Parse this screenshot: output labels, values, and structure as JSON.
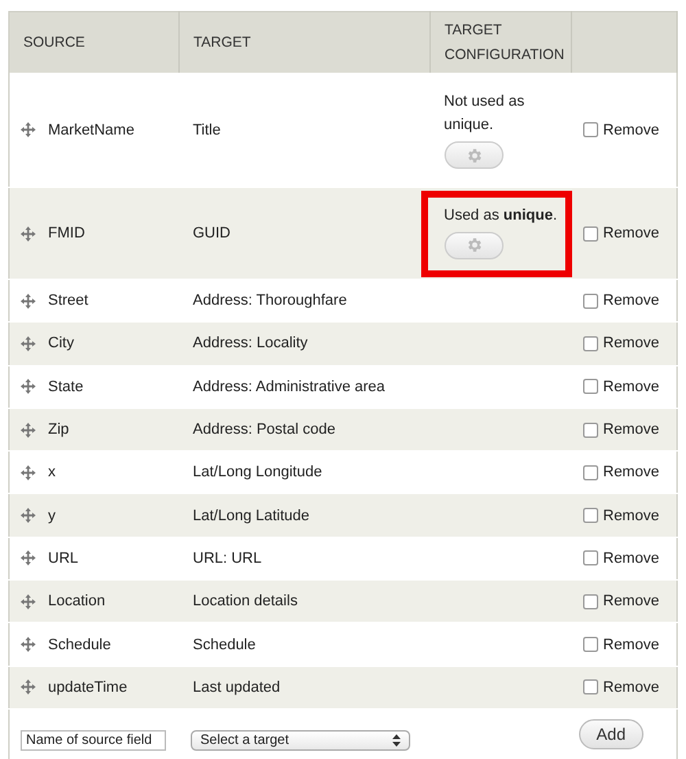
{
  "table": {
    "columns": [
      "SOURCE",
      "TARGET",
      "TARGET CONFIGURATION"
    ],
    "rows": [
      {
        "source": "MarketName",
        "target": "Title",
        "config": {
          "text": "Not used as unique.",
          "highlighted": false
        },
        "remove_label": "Remove",
        "remove_checked": false
      },
      {
        "source": "FMID",
        "target": "GUID",
        "config": {
          "text": "Used as **unique**.",
          "highlighted": true
        },
        "remove_label": "Remove",
        "remove_checked": false
      },
      {
        "source": "Street",
        "target": "Address: Thoroughfare",
        "remove_label": "Remove",
        "remove_checked": false
      },
      {
        "source": "City",
        "target": "Address: Locality",
        "remove_label": "Remove",
        "remove_checked": false
      },
      {
        "source": "State",
        "target": "Address: Administrative area",
        "remove_label": "Remove",
        "remove_checked": false
      },
      {
        "source": "Zip",
        "target": "Address: Postal code",
        "remove_label": "Remove",
        "remove_checked": false
      },
      {
        "source": "x",
        "target": "Lat/Long Longitude",
        "remove_label": "Remove",
        "remove_checked": false
      },
      {
        "source": "y",
        "target": "Lat/Long Latitude",
        "remove_label": "Remove",
        "remove_checked": false
      },
      {
        "source": "URL",
        "target": "URL: URL",
        "remove_label": "Remove",
        "remove_checked": false
      },
      {
        "source": "Location",
        "target": "Location details",
        "remove_label": "Remove",
        "remove_checked": false
      },
      {
        "source": "Schedule",
        "target": "Schedule",
        "remove_label": "Remove",
        "remove_checked": false
      },
      {
        "source": "updateTime",
        "target": "Last updated",
        "remove_label": "Remove",
        "remove_checked": false
      }
    ]
  },
  "add_row": {
    "source_field": {
      "value": "Name of source field"
    },
    "target_select": {
      "value": "Select a target"
    },
    "add_button": "Add"
  }
}
